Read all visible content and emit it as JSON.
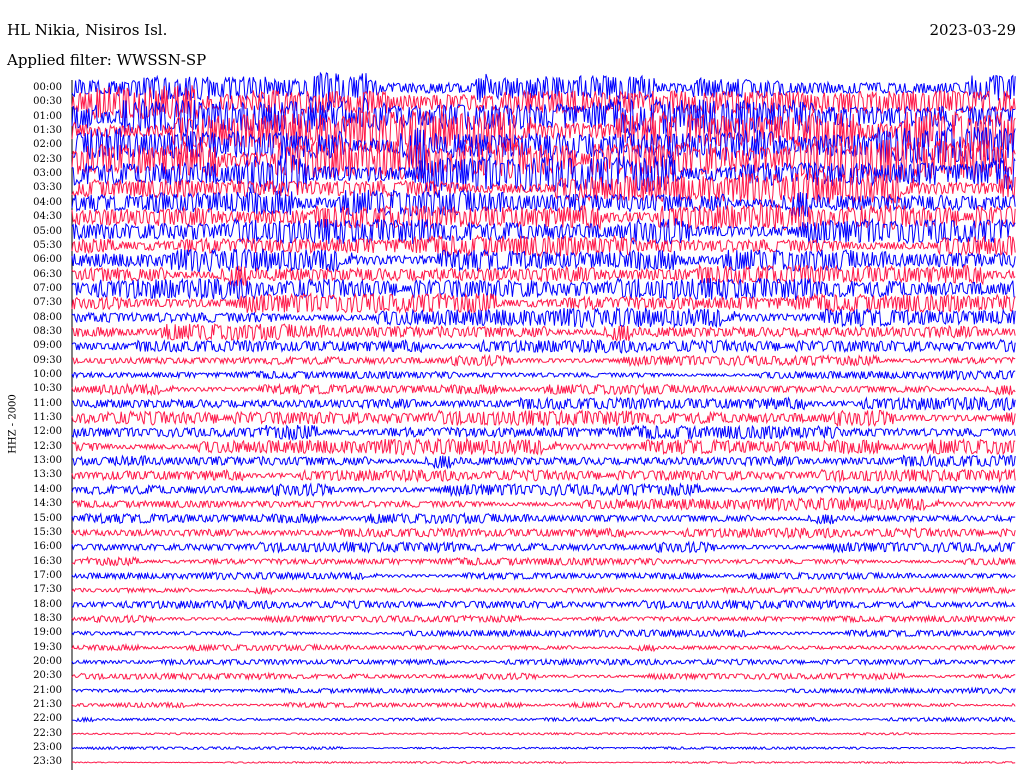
{
  "header": {
    "station": "HL Nikia, Nisiros Isl.",
    "date": "2023-03-29",
    "filter": "Applied filter: WWSSN-SP"
  },
  "colors": {
    "trace_a": "#0000ff",
    "trace_b": "#ff1a4b"
  },
  "chart_data": {
    "type": "line",
    "ylabel": "HHZ - 2000",
    "row_labels": [
      "00:00",
      "00:30",
      "01:00",
      "01:30",
      "02:00",
      "02:30",
      "03:00",
      "03:30",
      "04:00",
      "04:30",
      "05:00",
      "05:30",
      "06:00",
      "06:30",
      "07:00",
      "07:30",
      "08:00",
      "08:30",
      "09:00",
      "09:30",
      "10:00",
      "10:30",
      "11:00",
      "11:30",
      "12:00",
      "12:30",
      "13:00",
      "13:30",
      "14:00",
      "14:30",
      "15:00",
      "15:30",
      "16:00",
      "16:30",
      "17:00",
      "17:30",
      "18:00",
      "18:30",
      "19:00",
      "19:30",
      "20:00",
      "20:30",
      "21:00",
      "21:30",
      "22:00",
      "22:30",
      "23:00",
      "23:30"
    ],
    "relative_amplitude": [
      9,
      10,
      12,
      12,
      13,
      12,
      11,
      9,
      8,
      8,
      7.5,
      7,
      6.5,
      6.5,
      6.5,
      6,
      5.5,
      5,
      4,
      3,
      2.5,
      3,
      4,
      4.5,
      4.5,
      4.5,
      4,
      3.5,
      3.5,
      3.5,
      3,
      3,
      3,
      2.5,
      2,
      2,
      2.5,
      2,
      2,
      1.8,
      1.8,
      1.8,
      1.5,
      1.5,
      1.2,
      0.6,
      0.8,
      0.5
    ],
    "grid": false
  }
}
